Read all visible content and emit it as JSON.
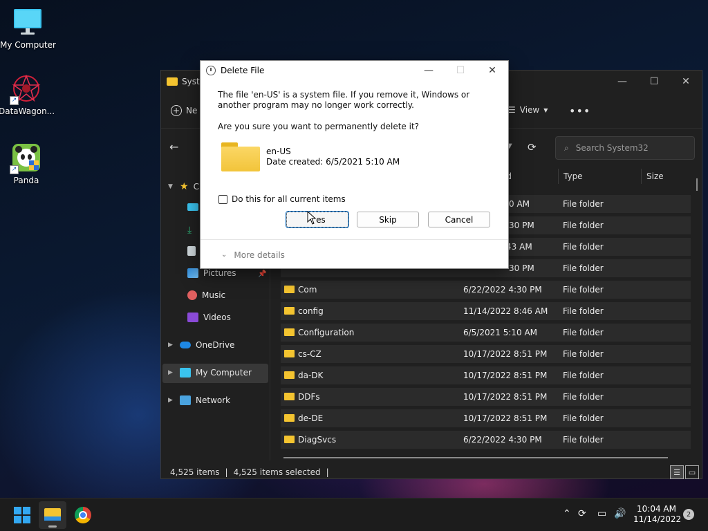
{
  "desktop": {
    "icons": [
      {
        "label": "My Computer",
        "icon": "monitor-icon"
      },
      {
        "label": "DataWagon...",
        "icon": "datawagon-icon"
      },
      {
        "label": "Panda",
        "icon": "panda-icon"
      }
    ]
  },
  "explorer": {
    "title": "System32",
    "title_visible": "Syste",
    "toolbar": {
      "new_label": "Ne",
      "view_label": "View",
      "more_label": "•••"
    },
    "search_placeholder": "Search System32",
    "nav": {
      "quick_access": "C",
      "items": [
        {
          "label": "Pictures",
          "icon": "pictures-icon"
        },
        {
          "label": "Music",
          "icon": "music-icon"
        },
        {
          "label": "Videos",
          "icon": "videos-icon"
        },
        {
          "label": "OneDrive",
          "icon": "onedrive-icon"
        },
        {
          "label": "My Computer",
          "icon": "computer-icon"
        },
        {
          "label": "Network",
          "icon": "network-icon"
        }
      ]
    },
    "columns": {
      "date_partial": "ed",
      "type": "Type",
      "size": "Size"
    },
    "rows": [
      {
        "name": "",
        "date": "0 AM",
        "type": "File folder"
      },
      {
        "name": "",
        "date": "30 PM",
        "type": "File folder"
      },
      {
        "name": "",
        "date": ":43 AM",
        "type": "File folder"
      },
      {
        "name": "",
        "date": "30 PM",
        "type": "File folder"
      },
      {
        "name": "Com",
        "date": "6/22/2022 4:30 PM",
        "type": "File folder"
      },
      {
        "name": "config",
        "date": "11/14/2022 8:46 AM",
        "type": "File folder"
      },
      {
        "name": "Configuration",
        "date": "6/5/2021 5:10 AM",
        "type": "File folder"
      },
      {
        "name": "cs-CZ",
        "date": "10/17/2022 8:51 PM",
        "type": "File folder"
      },
      {
        "name": "da-DK",
        "date": "10/17/2022 8:51 PM",
        "type": "File folder"
      },
      {
        "name": "DDFs",
        "date": "10/17/2022 8:51 PM",
        "type": "File folder"
      },
      {
        "name": "de-DE",
        "date": "10/17/2022 8:51 PM",
        "type": "File folder"
      },
      {
        "name": "DiagSvcs",
        "date": "6/22/2022 4:30 PM",
        "type": "File folder"
      }
    ],
    "status": {
      "count": "4,525 items",
      "selected": "4,525 items selected"
    }
  },
  "dialog": {
    "title": "Delete File",
    "message": "The file 'en-US' is a system file. If you remove it, Windows or another program may no longer work correctly.",
    "question": "Are you sure you want to permanently delete it?",
    "file_name": "en-US",
    "file_date": "Date created: 6/5/2021 5:10 AM",
    "checkbox_label": "Do this for all current items",
    "buttons": {
      "yes": "Yes",
      "yes_visible": "es",
      "skip": "Skip",
      "cancel": "Cancel"
    },
    "more_details": "More details"
  },
  "taskbar": {
    "time": "10:04 AM",
    "date": "11/14/2022",
    "notifications": "2"
  },
  "colors": {
    "folder": "#f4c430",
    "accent": "#0067c0",
    "explorer_bg": "#202020",
    "row_bg": "#2b2b2b"
  }
}
